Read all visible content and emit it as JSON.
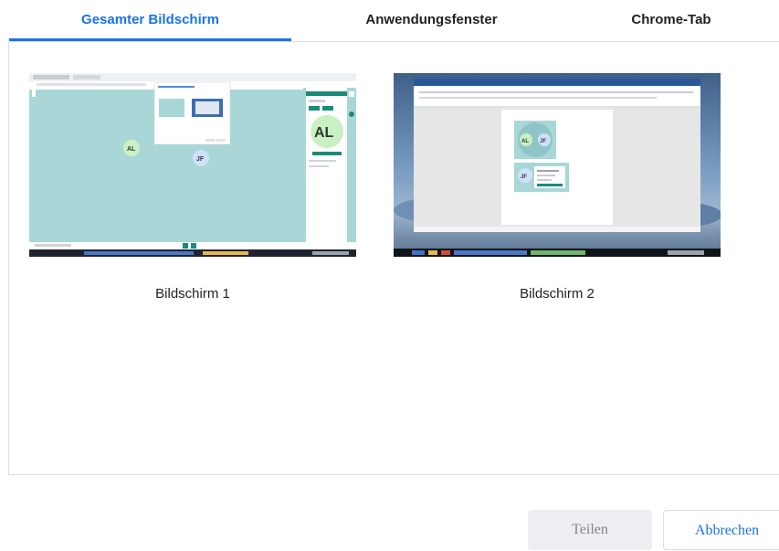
{
  "tabs": [
    {
      "label": "Gesamter Bildschirm",
      "active": true
    },
    {
      "label": "Anwendungsfenster",
      "active": false
    },
    {
      "label": "Chrome-Tab",
      "active": false
    }
  ],
  "screens": [
    {
      "caption": "Bildschirm 1",
      "avatar_large": "AL",
      "avatar_a": "AL",
      "avatar_b": "JF"
    },
    {
      "caption": "Bildschirm 2",
      "avatar_a": "AL",
      "avatar_b": "JF",
      "avatar_c": "JF"
    }
  ],
  "buttons": {
    "share": "Teilen",
    "cancel": "Abbrechen"
  },
  "colors": {
    "accent": "#1a73e8",
    "teal_canvas": "#a8d8d8",
    "teal_brand": "#1b8a7a"
  }
}
